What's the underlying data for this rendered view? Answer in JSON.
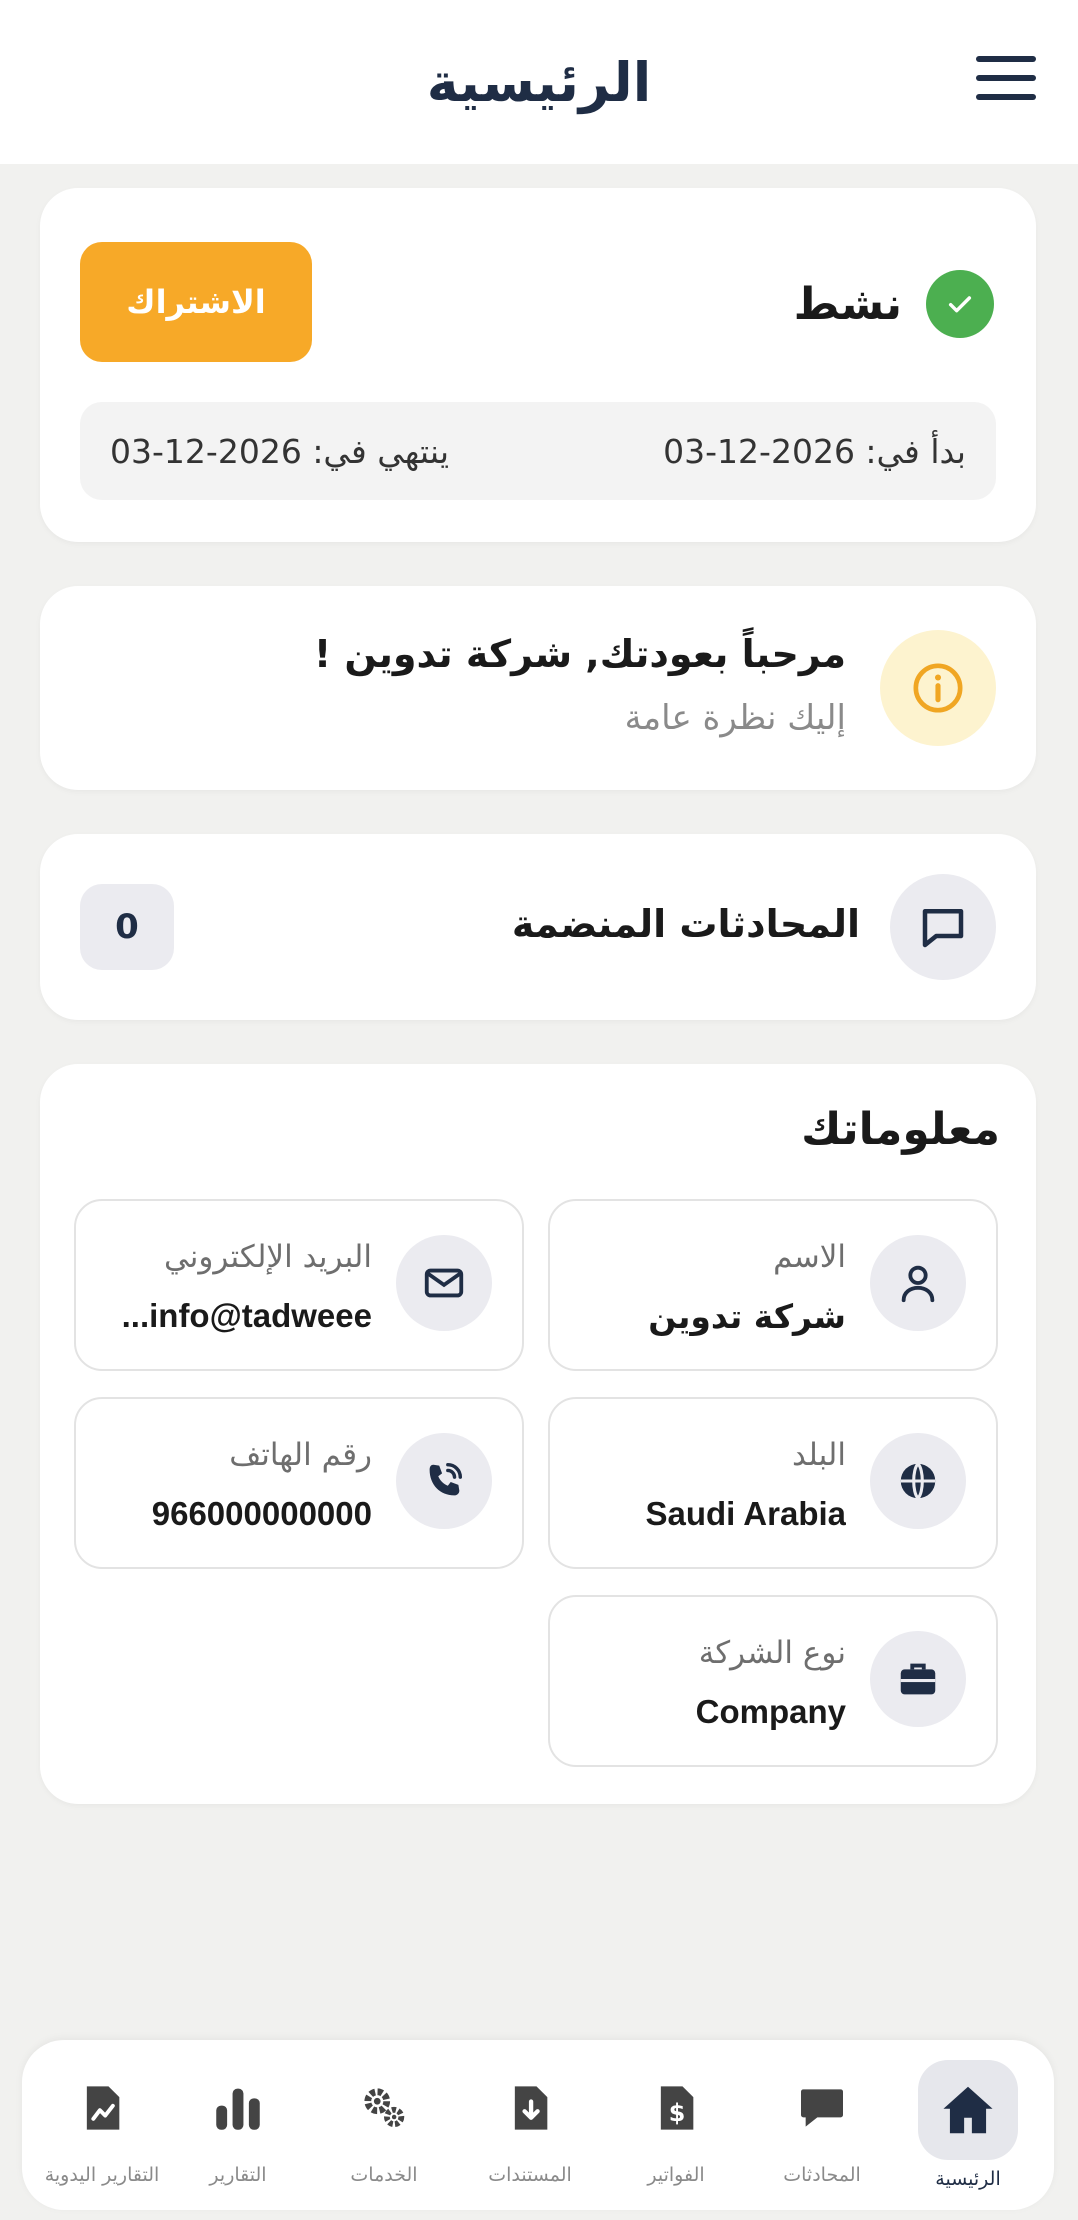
{
  "header": {
    "title": "الرئيسية",
    "menu_icon": "hamburger-menu-icon"
  },
  "subscription": {
    "status": "نشط",
    "button_label": "الاشتراك",
    "started": "بدأ في: 2026-12-03",
    "ends": "ينتهي في: 2026-12-03",
    "status_color": "#4caf50",
    "button_color": "#f7a928"
  },
  "welcome": {
    "title": "مرحباً بعودتك, شركة تدوين !",
    "subtitle": "إليك نظرة عامة"
  },
  "conversations": {
    "title": "المحادثات المنضمة",
    "count": "0"
  },
  "info": {
    "title": "معلوماتك",
    "name": {
      "label": "الاسم",
      "value": "شركة تدوين",
      "icon": "user-icon"
    },
    "email": {
      "label": "البريد الإلكتروني",
      "value": "...info@tadweee",
      "icon": "envelope-icon"
    },
    "country": {
      "label": "البلد",
      "value": "Saudi Arabia",
      "icon": "globe-icon"
    },
    "phone": {
      "label": "رقم الهاتف",
      "value": "966000000000",
      "icon": "phone-icon"
    },
    "company_type": {
      "label": "نوع الشركة",
      "value": "Company",
      "icon": "briefcase-icon"
    }
  },
  "nav": {
    "items": [
      {
        "label": "الرئيسية",
        "icon": "home-icon",
        "active": true
      },
      {
        "label": "المحادثات",
        "icon": "chat-bubble-icon"
      },
      {
        "label": "الفواتير",
        "icon": "invoice-icon"
      },
      {
        "label": "المستندات",
        "icon": "document-download-icon"
      },
      {
        "label": "الخدمات",
        "icon": "gears-icon"
      },
      {
        "label": "التقارير",
        "icon": "bar-chart-icon"
      },
      {
        "label": "التقارير اليدوية",
        "icon": "file-chart-icon"
      }
    ]
  },
  "colors": {
    "primary": "#1f2d45",
    "background": "#f1f1ef"
  }
}
